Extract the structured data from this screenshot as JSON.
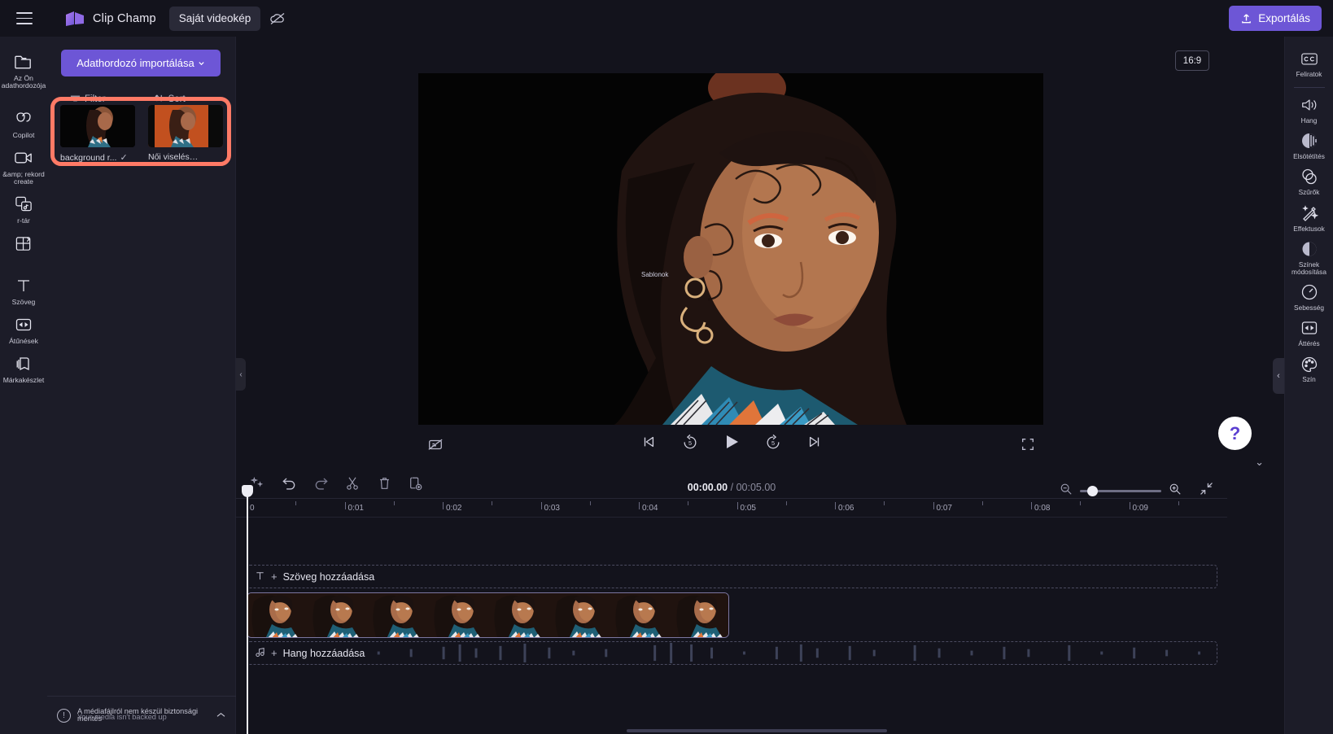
{
  "app": {
    "brand": "Clip Champ",
    "project_name": "Saját videokép",
    "export_label": "Exportálás",
    "accent": "#6d56d6",
    "highlight": "#ff7a66"
  },
  "left_rail": {
    "items": [
      {
        "label": "Az Ön adathordozója",
        "icon": "folder-icon"
      },
      {
        "label": "Copilot",
        "icon": "copilot-icon"
      },
      {
        "label": "&amp; rekord create",
        "icon": "record-create-icon"
      },
      {
        "label": "r-tár",
        "icon": "content-library-icon"
      },
      {
        "label": "",
        "icon": "templates-icon"
      },
      {
        "label": "Szöveg",
        "icon": "text-icon"
      },
      {
        "label": "Átűnések",
        "icon": "transitions-icon"
      },
      {
        "label": "Márkakészlet",
        "icon": "brandkit-icon"
      }
    ]
  },
  "media_panel": {
    "import_button": "Adathordozó importálása",
    "filter_label": "Filter",
    "sort_label": "Sort",
    "items": [
      {
        "name": "background r...",
        "selected": true
      },
      {
        "name": "Női viselés…",
        "selected": false
      }
    ],
    "backup_notice": "A médiafájlról nem készül biztonsági mentés",
    "backup_notice_sub": "Your media isn't backed up"
  },
  "preview": {
    "aspect_ratio": "16:9",
    "overlay_label": "Sablonok",
    "controls": {
      "captions_toggle": "captions-off-icon",
      "skip_start": "skip-to-start-icon",
      "back5": "rewind-5-icon",
      "play": "play-icon",
      "forward5": "forward-5-icon",
      "skip_end": "skip-to-end-icon",
      "fullscreen": "fullscreen-icon"
    },
    "help": "?"
  },
  "right_rail": {
    "items": [
      {
        "label": "Feliratok",
        "icon": "captions-cc-icon"
      },
      {
        "label": "Hang",
        "icon": "audio-icon"
      },
      {
        "label": "Elsötétítés",
        "icon": "fade-icon"
      },
      {
        "label": "Szűrők",
        "icon": "filters-icon"
      },
      {
        "label": "Effektusok",
        "icon": "effects-icon"
      },
      {
        "label": "Színek módosítása",
        "icon": "adjust-colors-icon"
      },
      {
        "label": "Sebesség",
        "icon": "speed-icon"
      },
      {
        "label": "Áttérés",
        "icon": "transition-icon"
      },
      {
        "label": "Szín",
        "icon": "color-icon"
      }
    ]
  },
  "timeline": {
    "tools": [
      {
        "name": "magic-wand-icon"
      },
      {
        "name": "undo-icon"
      },
      {
        "name": "redo-icon"
      },
      {
        "name": "split-scissors-icon"
      },
      {
        "name": "delete-trash-icon"
      },
      {
        "name": "duplicate-icon"
      }
    ],
    "current_time": "00:00.00",
    "separator": "/",
    "total_time": "00:05.00",
    "zoom_out_icon": "zoom-out-icon",
    "zoom_in_icon": "zoom-in-icon",
    "fit_icon": "fit-to-screen-icon",
    "zoom_value": 9,
    "ruler_ticks": [
      "0",
      "0:01",
      "0:02",
      "0:03",
      "0:04",
      "0:05",
      "0:06",
      "0:07",
      "0:08",
      "0:09"
    ],
    "text_track_label": "Szöveg hozzáadása",
    "audio_track_label": "Hang hozzáadása",
    "video_clip_frames": 8
  }
}
